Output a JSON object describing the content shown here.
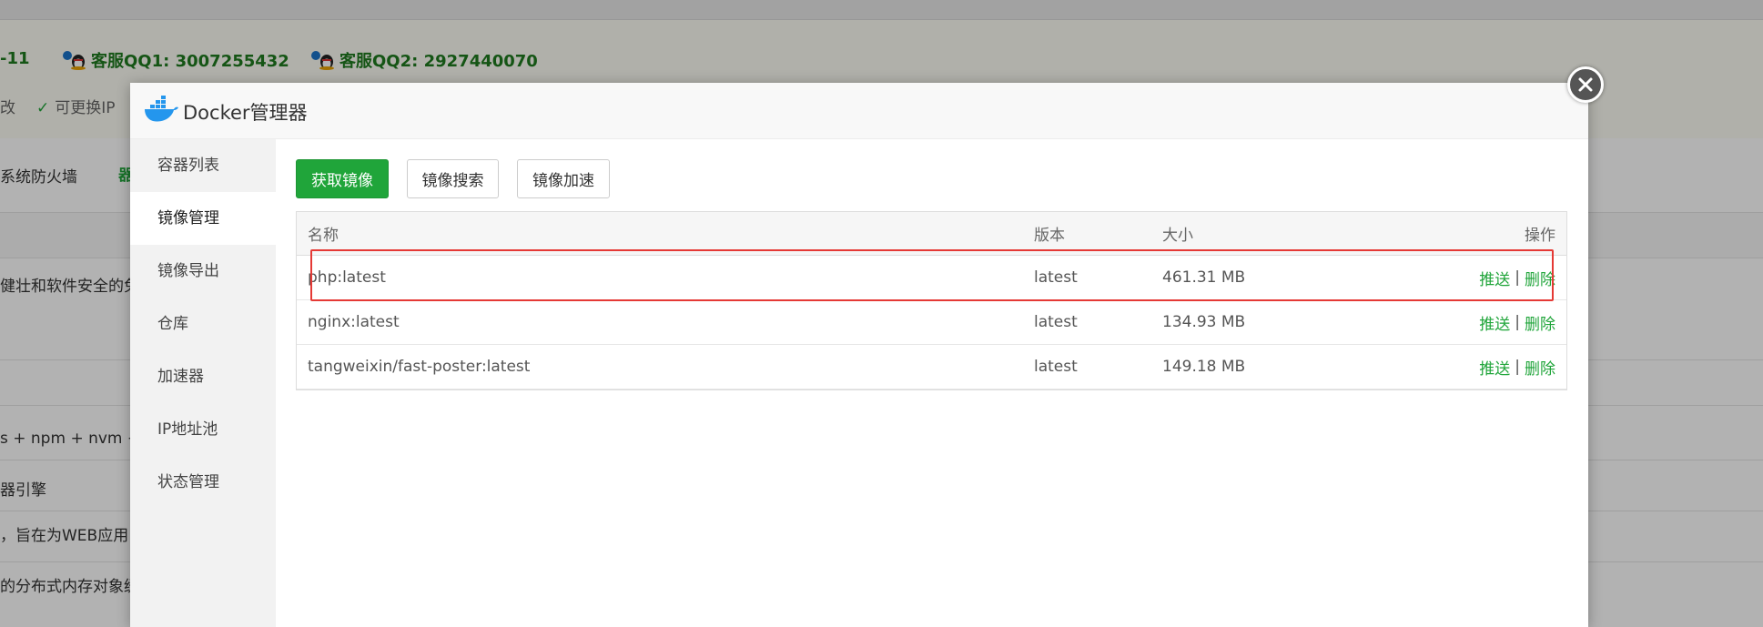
{
  "background": {
    "topbar_left": "-11",
    "qq1": "客服QQ1: 3007255432",
    "qq2": "客服QQ2: 2927440070",
    "row1_left": "改",
    "row1_feature": "可更换IP",
    "row2_left": "系统防火墙",
    "row2_green": "器",
    "row3": "健壮和软件安全的免",
    "row4": "s + npm + nvm +",
    "row5": "器引擎",
    "row6": "，旨在为WEB应用",
    "row7": "的分布式内存对象缓"
  },
  "modal": {
    "title": "Docker管理器",
    "close_icon": "close-icon",
    "nav": [
      {
        "label": "容器列表",
        "active": false
      },
      {
        "label": "镜像管理",
        "active": true
      },
      {
        "label": "镜像导出",
        "active": false
      },
      {
        "label": "仓库",
        "active": false
      },
      {
        "label": "加速器",
        "active": false
      },
      {
        "label": "IP地址池",
        "active": false
      },
      {
        "label": "状态管理",
        "active": false
      }
    ],
    "toolbar": {
      "pull_image": "获取镜像",
      "search_image": "镜像搜索",
      "image_accel": "镜像加速"
    },
    "table": {
      "headers": {
        "name": "名称",
        "version": "版本",
        "size": "大小",
        "ops": "操作"
      },
      "rows": [
        {
          "name": "php:latest",
          "version": "latest",
          "size": "461.31 MB",
          "push": "推送",
          "sep": "|",
          "delete": "删除"
        },
        {
          "name": "nginx:latest",
          "version": "latest",
          "size": "134.93 MB",
          "push": "推送",
          "sep": "|",
          "delete": "删除"
        },
        {
          "name": "tangweixin/fast-poster:latest",
          "version": "latest",
          "size": "149.18 MB",
          "push": "推送",
          "sep": "|",
          "delete": "删除"
        }
      ]
    }
  },
  "colors": {
    "primary": "#20a53a",
    "highlight": "#e53935"
  }
}
